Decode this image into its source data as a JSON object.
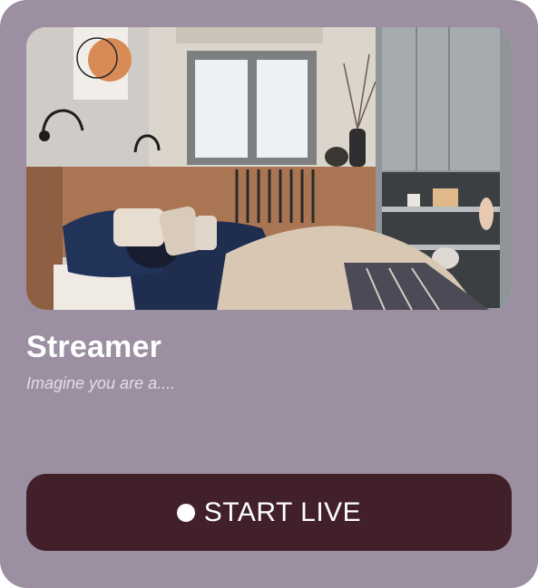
{
  "card": {
    "title": "Streamer",
    "subtitle": "Imagine you are a....",
    "image_description": "bedroom-photo"
  },
  "action": {
    "label": "START LIVE",
    "icon": "live-dot-icon"
  },
  "colors": {
    "card_background": "#9c8fa1",
    "button_background": "#41202a",
    "text_primary": "#ffffff",
    "text_secondary": "#e3dde6"
  }
}
